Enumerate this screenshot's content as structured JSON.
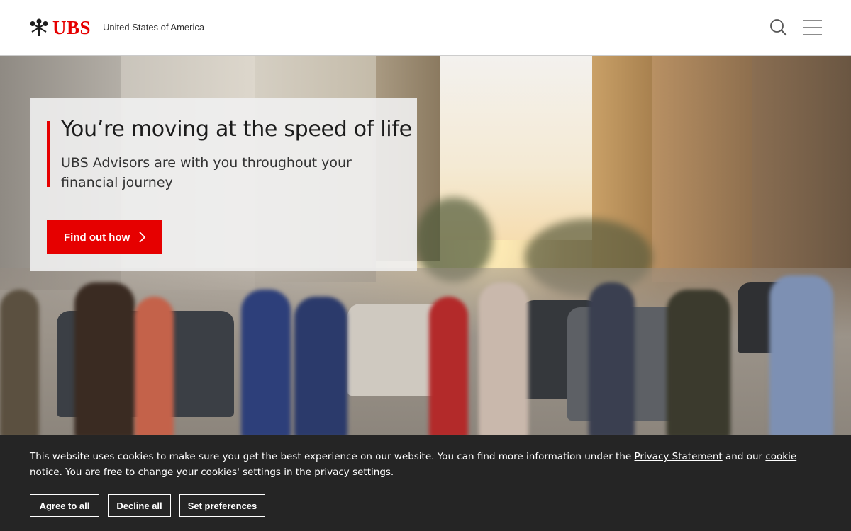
{
  "header": {
    "logo_text": "UBS",
    "region": "United States of America",
    "icons": {
      "logo": "keys-icon",
      "search": "search-icon",
      "menu": "hamburger-menu-icon"
    }
  },
  "hero": {
    "title": "You’re moving at the speed of life",
    "subtitle": "UBS Advisors are with you throughout your financial journey",
    "cta_label": "Find out how",
    "cta_icon": "chevron-right-icon"
  },
  "cookie_banner": {
    "text_before": "This website uses cookies to make sure you get the best experience on our website. You can find more information under the ",
    "privacy_link": "Privacy Statement",
    "text_middle": " and our ",
    "cookie_link": "cookie notice",
    "text_after": ". You are free to change your cookies' settings in the privacy settings.",
    "buttons": {
      "agree": "Agree to all",
      "decline": "Decline all",
      "preferences": "Set preferences"
    }
  },
  "colors": {
    "brand_red": "#e60000",
    "banner_bg": "#252525"
  }
}
